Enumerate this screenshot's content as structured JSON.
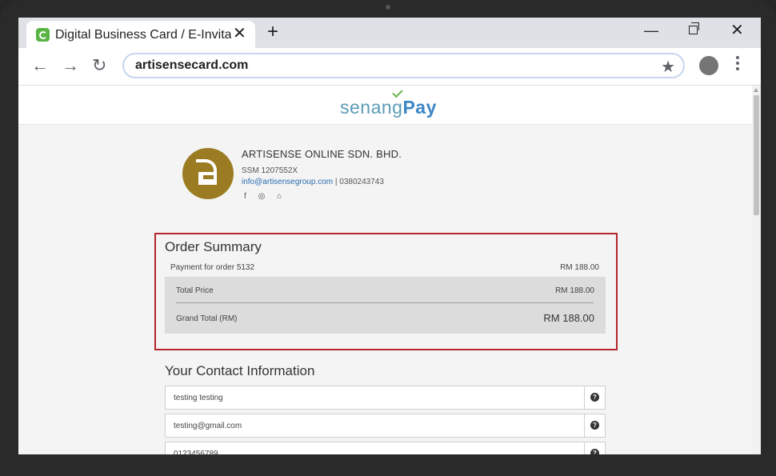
{
  "browser": {
    "tab_title": "Digital Business Card / E-Invita",
    "tab_close": "✕",
    "new_tab": "+",
    "minimize": "—",
    "close": "✕",
    "back": "←",
    "forward": "→",
    "reload": "↻",
    "url": "artisensecard.com",
    "star": "★"
  },
  "header": {
    "logo_senang": "senang",
    "logo_pay": "Pay"
  },
  "merchant": {
    "name": "ARTISENSE ONLINE SDN. BHD.",
    "ssm": "SSM 1207552X",
    "email": "info@artisensegroup.com",
    "separator": " | ",
    "phone": "0380243743",
    "social": {
      "facebook": "f",
      "instagram": "◎",
      "home": "⌂"
    }
  },
  "order_summary": {
    "title": "Order Summary",
    "item_label": "Payment for order 5132",
    "item_amount": "RM 188.00",
    "total_label": "Total Price",
    "total_amount": "RM 188.00",
    "grand_label": "Grand Total (RM)",
    "grand_amount": "RM 188.00"
  },
  "contact": {
    "title": "Your Contact Information",
    "name_value": "testing testing",
    "email_value": "testing@gmail.com",
    "phone_value": "0123456789",
    "help": "?"
  },
  "colors": {
    "highlight_border": "#b3262d",
    "merchant_gold": "#9b7c23",
    "link_blue": "#2b6cb0"
  }
}
